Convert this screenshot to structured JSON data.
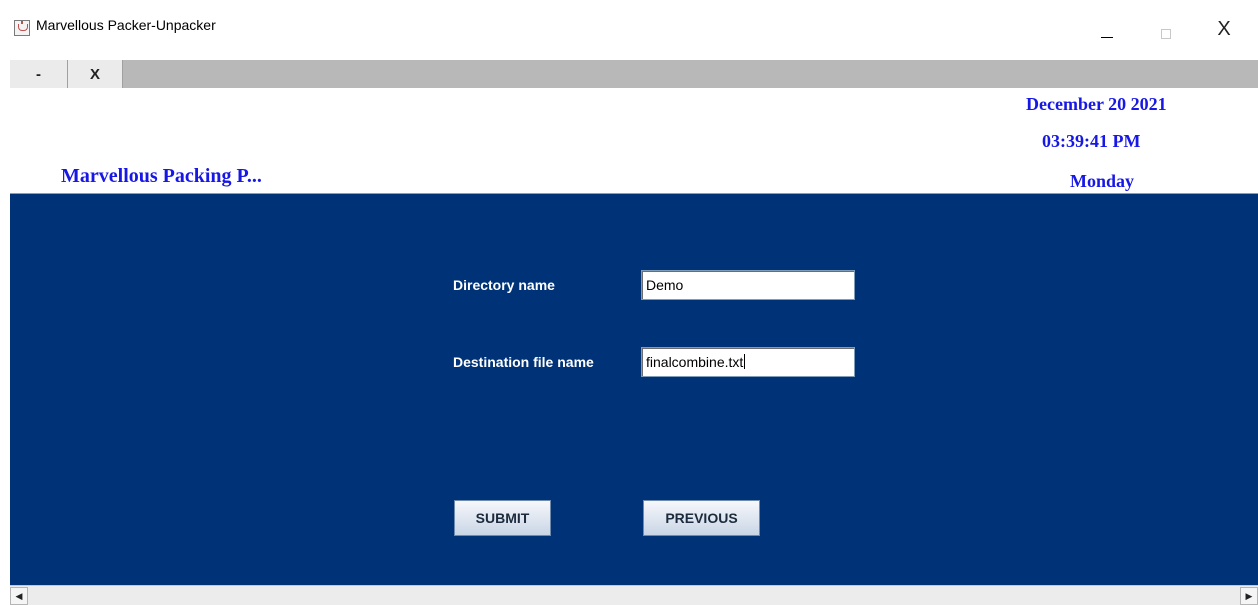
{
  "window": {
    "title": "Marvellous Packer-Unpacker",
    "icon": "java-coffee-icon",
    "minimize_icon": "minimize-icon",
    "maximize_icon": "maximize-icon",
    "close_glyph": "X"
  },
  "inner_bar": {
    "minimize_label": "-",
    "close_label": "X"
  },
  "header": {
    "title": "Marvellous Packing P...",
    "date": "December 20 2021",
    "time": "03:39:41 PM",
    "day": "Monday",
    "text_color": "#1717e6"
  },
  "form": {
    "directory_label": "Directory name",
    "directory_value": "Demo",
    "destination_label": "Destination file name",
    "destination_value": "finalcombine.txt",
    "panel_color": "#003277"
  },
  "buttons": {
    "submit": "SUBMIT",
    "previous": "PREVIOUS"
  },
  "scrollbar": {
    "left_glyph": "◀",
    "right_glyph": "▶"
  }
}
